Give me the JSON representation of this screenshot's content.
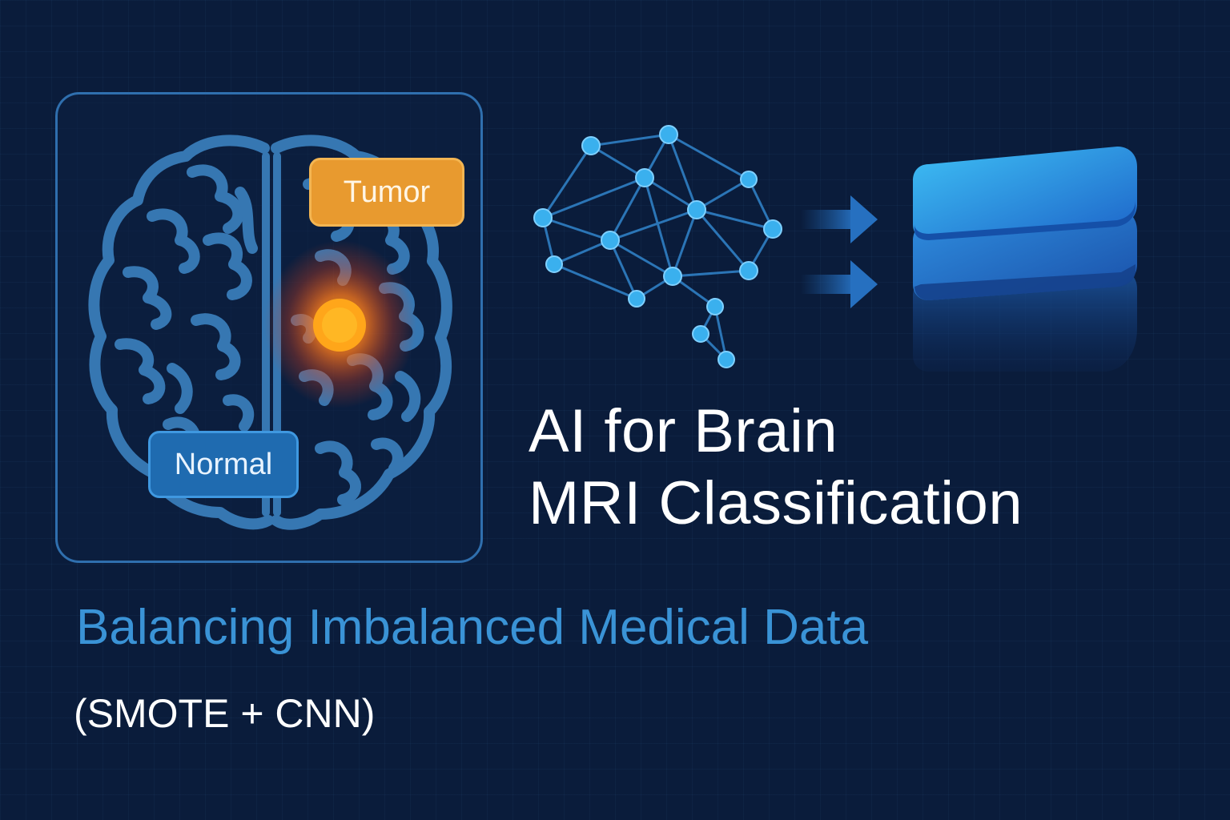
{
  "background_color": "#0a1c3b",
  "accent_colors": {
    "frame": "#2f6fae",
    "brain_outline": "#3a78b4",
    "tumor_glow": "#ff6a1a",
    "tumor_core": "#ffb020",
    "network": "#3aa8e8",
    "layers": "#2c86dc"
  },
  "illustration": {
    "tumor_label": "Tumor",
    "normal_label": "Normal",
    "brain_icon": "brain-mri-icon",
    "network_icon": "neural-network-brain-icon",
    "arrow_icon": "arrow-right-icon",
    "layers_icon": "stacked-layers-icon"
  },
  "title": {
    "line1": "AI for Brain",
    "line2": "MRI Classification"
  },
  "subtitle": "Balancing Imbalanced Medical Data",
  "method": "(SMOTE + CNN)"
}
